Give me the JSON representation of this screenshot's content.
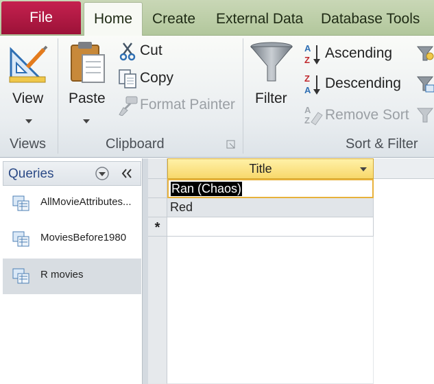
{
  "tabs": {
    "file": "File",
    "home": "Home",
    "create": "Create",
    "external": "External Data",
    "dbtools": "Database Tools"
  },
  "ribbon": {
    "views": {
      "view_label": "View",
      "group_label": "Views"
    },
    "clipboard": {
      "paste_label": "Paste",
      "cut_label": "Cut",
      "copy_label": "Copy",
      "format_painter_label": "Format Painter",
      "group_label": "Clipboard"
    },
    "sort_filter": {
      "filter_label": "Filter",
      "ascending_label": "Ascending",
      "descending_label": "Descending",
      "remove_sort_label": "Remove Sort",
      "group_label": "Sort & Filter"
    }
  },
  "nav": {
    "title": "Queries",
    "items": [
      {
        "label": "AllMovieAttributes..."
      },
      {
        "label": "MoviesBefore1980"
      },
      {
        "label": "R movies"
      }
    ]
  },
  "datasheet": {
    "column_header": "Title",
    "rows": [
      "Ran (Chaos)",
      "Red"
    ],
    "new_row_marker": "*"
  },
  "colors": {
    "file_tab": "#b01a44",
    "tab_bar": "#bccfa8",
    "header_highlight": "#f8d86b",
    "selected_nav": "#d8dde2"
  }
}
